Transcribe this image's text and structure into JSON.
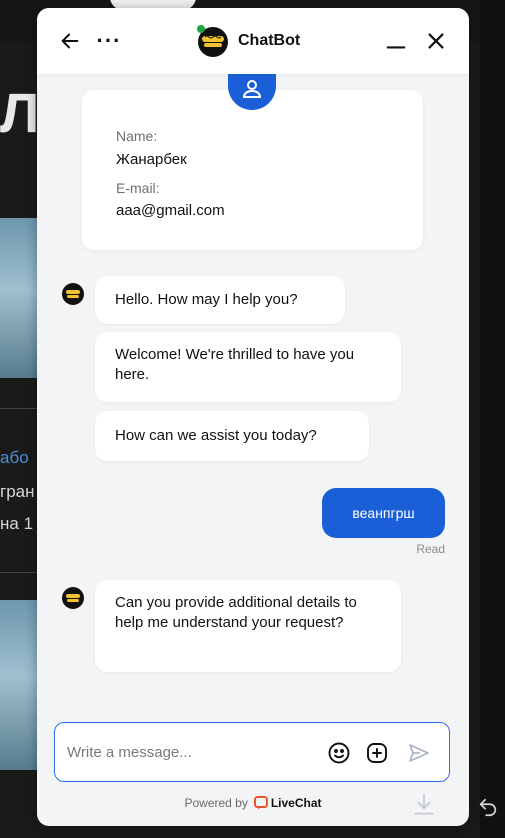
{
  "background": {
    "title_fragment": "ЛУ",
    "link_fragment": "або",
    "text_lines": [
      "гран",
      "на 1"
    ]
  },
  "header": {
    "app_name": "ChatBot",
    "more_label": "···"
  },
  "profile": {
    "name_label": "Name:",
    "name_value": "Жанарбек",
    "email_label": "E-mail:",
    "email_value": "aaa@gmail.com"
  },
  "messages": {
    "bot_1": "Hello. How may I help you?",
    "bot_2": "Welcome! We're thrilled to have you here.",
    "bot_3": "How can we assist you today?",
    "user_1": "веанпгрш",
    "user_1_status": "Read",
    "bot_4": "Can you provide additional details to help me understand your request?"
  },
  "composer": {
    "placeholder": "Write a message...",
    "value": ""
  },
  "footer": {
    "powered_by": "Powered by",
    "brand": "LiveChat"
  },
  "colors": {
    "accent": "#1a5fd8",
    "brand_orange": "#e8552d",
    "panel_bg": "#f3f4f6"
  },
  "icons": {
    "back": "arrow-left-icon",
    "minimize": "minimize-icon",
    "close": "close-icon",
    "emoji": "smiley-icon",
    "attach": "plus-square-icon",
    "send": "send-icon",
    "download": "download-icon"
  }
}
